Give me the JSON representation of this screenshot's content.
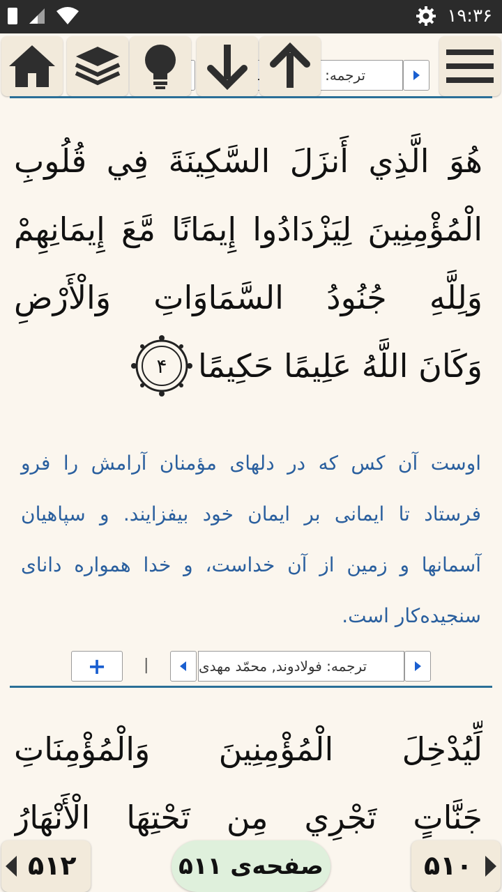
{
  "status": {
    "time": "۱۹:۳۶"
  },
  "toolbar": {
    "translation_label": "ترجمه: فولادوند, محمّد مهدی"
  },
  "verse1": {
    "arabic_lines": [
      "هُوَ الَّذِي أَنزَلَ السَّكِينَةَ فِي قُلُوبِ",
      "الْمُؤْمِنِينَ لِيَزْدَادُوا إِيمَانًا مَّعَ إِيمَانِهِمْ",
      "وَلِلَّهِ جُنُودُ السَّمَاوَاتِ وَالْأَرْضِ",
      "وَكَانَ اللَّهُ عَلِيمًا حَكِيمًا"
    ],
    "ayah_number": "۴",
    "translation": "اوست آن کس که در دلهای مؤمنان آرامش را فرو فرستاد تا ایمانی بر ایمان خود بیفزایند. و سپاهیان آسمانها و زمین از آن خداست، و خدا همواره دانای سنجیده‌کار است."
  },
  "trans_row": {
    "label": "ترجمه: فولادوند, محمّد مهدی",
    "add": "+",
    "separator": "|"
  },
  "verse2": {
    "arabic_lines": [
      "لِّيُدْخِلَ الْمُؤْمِنِينَ وَالْمُؤْمِنَاتِ",
      "جَنَّاتٍ تَجْرِي مِن تَحْتِهَا الْأَنْهَارُ"
    ]
  },
  "bottom": {
    "prev_page": "۵۱۲",
    "next_page": "۵۱۰",
    "current_page": "صفحه‌ی ۵۱۱"
  }
}
